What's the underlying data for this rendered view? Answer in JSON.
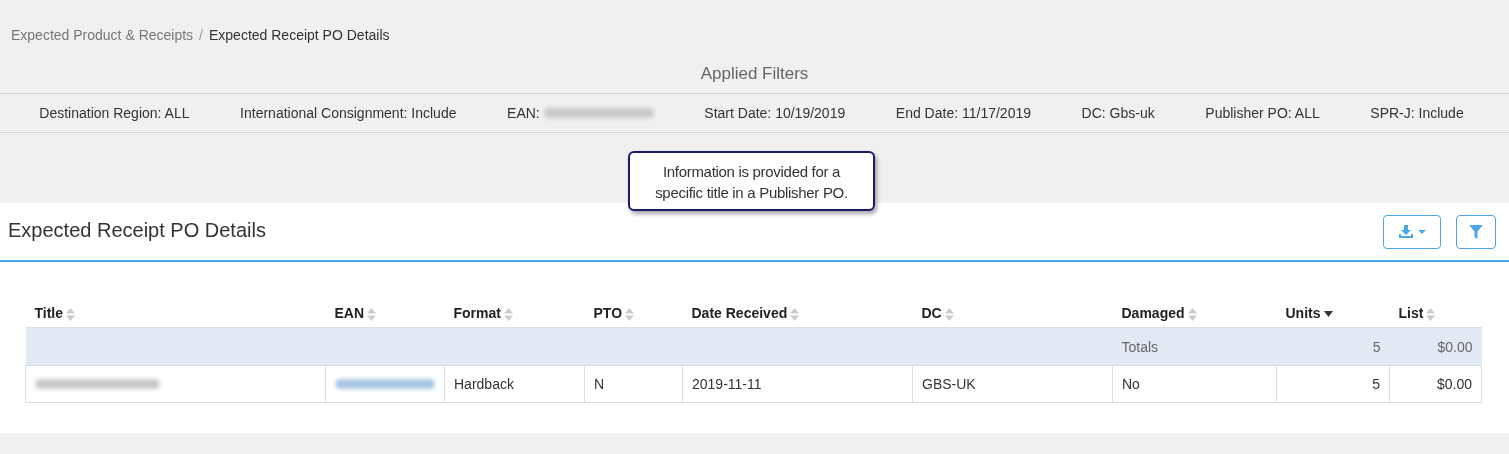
{
  "breadcrumb_separator": "/",
  "breadcrumb": [
    {
      "label": "Expected Product & Receipts",
      "current": false
    },
    {
      "label": "Expected Receipt PO Details",
      "current": true
    }
  ],
  "filters": {
    "title": "Applied Filters",
    "items": [
      {
        "text": "Destination Region: ALL",
        "redacted": false
      },
      {
        "text": "International Consignment: Include",
        "redacted": false
      },
      {
        "text": "EAN:",
        "redacted": true
      },
      {
        "text": "Start Date: 10/19/2019",
        "redacted": false
      },
      {
        "text": "End Date: 11/17/2019",
        "redacted": false
      },
      {
        "text": "DC: Gbs-uk",
        "redacted": false
      },
      {
        "text": "Publisher PO: ALL",
        "redacted": false
      },
      {
        "text": "SPR-J: Include",
        "redacted": false
      }
    ]
  },
  "tooltip": "Information is provided for a specific title in a Publisher PO.",
  "panel": {
    "title": "Expected Receipt PO Details",
    "table": {
      "columns": [
        {
          "label": "Title",
          "sorted": false
        },
        {
          "label": "EAN",
          "sorted": false
        },
        {
          "label": "Format",
          "sorted": false
        },
        {
          "label": "PTO",
          "sorted": false
        },
        {
          "label": "Date Received",
          "sorted": false
        },
        {
          "label": "DC",
          "sorted": false
        },
        {
          "label": "Damaged",
          "sorted": false
        },
        {
          "label": "Units",
          "sorted": true
        },
        {
          "label": "List",
          "sorted": false
        }
      ],
      "totals": {
        "label": "Totals",
        "units": "5",
        "list": "$0.00"
      },
      "rows": [
        {
          "cells": [
            {
              "kind": "redacted"
            },
            {
              "kind": "redacted-link"
            },
            {
              "kind": "text",
              "text": "Hardback"
            },
            {
              "kind": "text",
              "text": "N"
            },
            {
              "kind": "text",
              "text": "2019-11-11"
            },
            {
              "kind": "text",
              "text": "GBS-UK"
            },
            {
              "kind": "text",
              "text": "No"
            },
            {
              "kind": "text",
              "text": "5"
            },
            {
              "kind": "text",
              "text": "$0.00"
            }
          ]
        }
      ]
    }
  }
}
